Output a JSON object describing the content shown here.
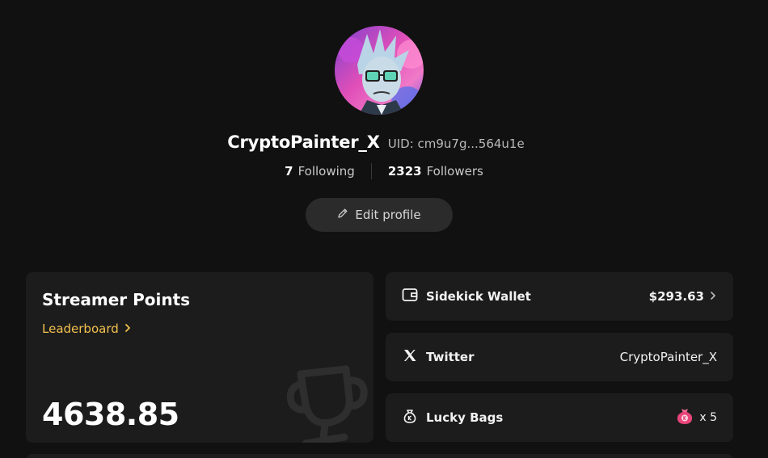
{
  "profile": {
    "username": "CryptoPainter_X",
    "uid": "UID: cm9u7g...564u1e",
    "following_count": "7",
    "following_label": "Following",
    "followers_count": "2323",
    "followers_label": "Followers",
    "edit_label": "Edit profile"
  },
  "points": {
    "title": "Streamer Points",
    "link_label": "Leaderboard",
    "value": "4638.85"
  },
  "wallet": {
    "label": "Sidekick Wallet",
    "value": "$293.63"
  },
  "twitter": {
    "label": "Twitter",
    "value": "CryptoPainter_X"
  },
  "lucky_bags": {
    "label": "Lucky Bags",
    "count": "x 5"
  },
  "colors": {
    "background": "#111111",
    "card": "#1c1c1c",
    "accent_link": "#f2c14e",
    "bag_pink": "#e8457a"
  },
  "icons": {
    "edit": "pencil-icon",
    "leaderboard": "chevron-right-icon",
    "trophy": "trophy-icon",
    "wallet": "wallet-icon",
    "twitter": "x-logo-icon",
    "lucky_bags": "money-bag-icon"
  }
}
